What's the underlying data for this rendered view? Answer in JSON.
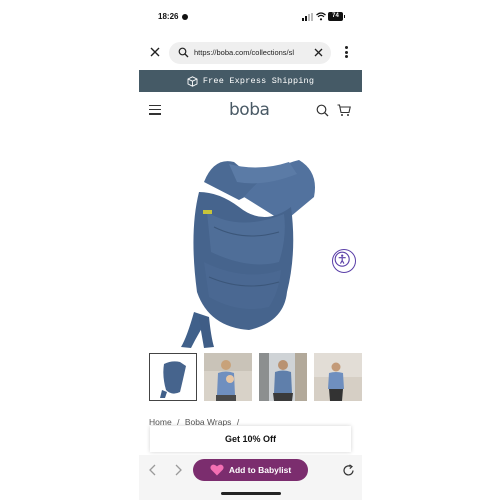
{
  "status_bar": {
    "time": "18:26",
    "battery": "74"
  },
  "browser": {
    "url": "https://boba.com/collections/sl"
  },
  "banner": {
    "text": "Free Express Shipping"
  },
  "header": {
    "logo": "boba"
  },
  "product": {
    "thumbnails": [
      {
        "label": "carrier-only"
      },
      {
        "label": "model-front"
      },
      {
        "label": "model-street"
      },
      {
        "label": "model-wall"
      }
    ]
  },
  "breadcrumb": {
    "items": [
      "Home",
      "/",
      "Boba Wraps",
      "/"
    ]
  },
  "promo": {
    "text": "Get 10% Off"
  },
  "bottom_bar": {
    "babylist_label": "Add to Babylist"
  },
  "colors": {
    "banner": "#455a66",
    "carrier": "#4b6a94",
    "babylist": "#7b2d6e",
    "accessibility": "#5a3fa8"
  }
}
